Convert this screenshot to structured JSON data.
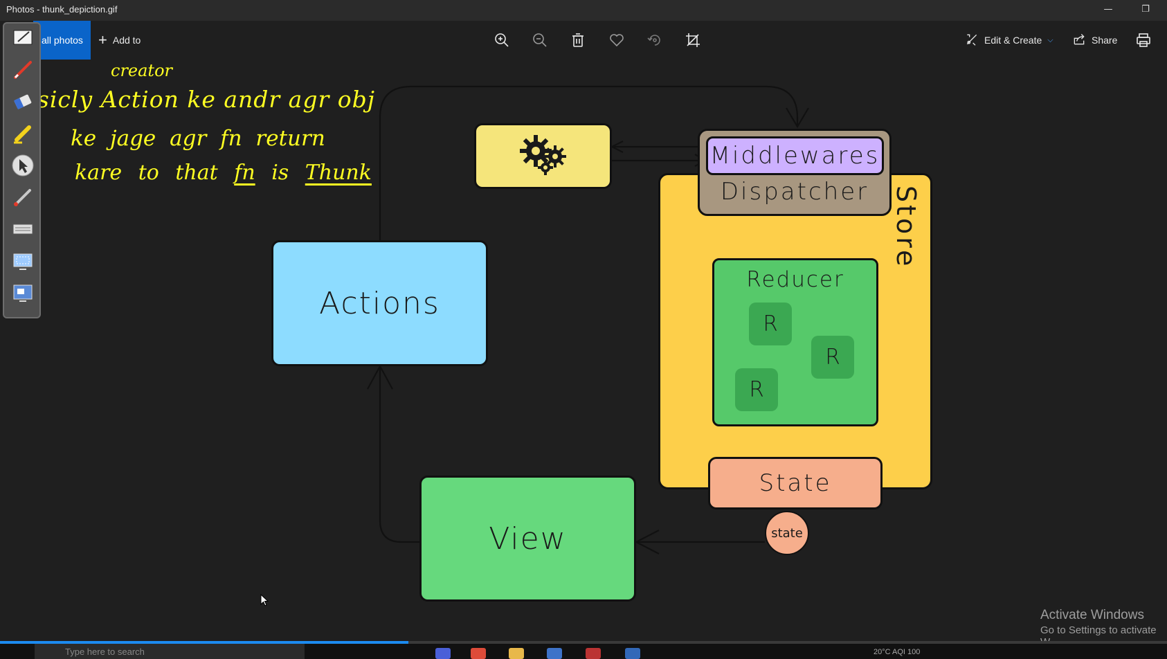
{
  "window": {
    "title": "Photos - thunk_depiction.gif",
    "minimize_glyph": "—",
    "restore_glyph": "❐"
  },
  "toolbar": {
    "all_photos_label": "all photos",
    "add_to_label": "Add to",
    "edit_create_label": "Edit & Create",
    "share_label": "Share",
    "icons": [
      "zoom-in-icon",
      "zoom-out-icon",
      "delete-icon",
      "favorite-icon",
      "rotate-icon",
      "crop-icon",
      "print-icon"
    ]
  },
  "pen_toolbox": {
    "tools": [
      "whiteboard-icon",
      "pen-icon",
      "eraser-icon",
      "highlighter-icon",
      "pointer-icon",
      "laser-pen-icon",
      "keyboard-icon",
      "screen-capture-icon",
      "screen-switch-icon"
    ]
  },
  "handwriting": {
    "line1": "creator",
    "line2": "Basicly Action ke andr agr obj",
    "line3": "ke jage agr fn return",
    "line4_prefix": "kare to that",
    "line4_fn": "fn",
    "line4_is": "is",
    "line4_thunk": "Thunk"
  },
  "diagram": {
    "actions_label": "Actions",
    "view_label": "View",
    "store_label": "Store",
    "middlewares_label": "Middlewares",
    "dispatcher_label": "Dispatcher",
    "reducer_label": "Reducer",
    "r_label": "R",
    "state_label": "State",
    "state_bubble_label": "state",
    "gear_icon": "gears-icon",
    "colors": {
      "actions": "#8ddcff",
      "view": "#66d97d",
      "gears": "#f5e57b",
      "store": "#fdcf4a",
      "dispatcher": "#a89780",
      "middlewares": "#cdb1ff",
      "reducer": "#56c96a",
      "reducer_chip": "#3ba852",
      "state": "#f6ae8c"
    }
  },
  "watermark": {
    "line1": "Activate Windows",
    "line2": "Go to Settings to activate W"
  },
  "taskbar": {
    "search_placeholder": "Type here to search",
    "tray_text": "20°C  AQI 100",
    "playback_progress": 0.35
  }
}
